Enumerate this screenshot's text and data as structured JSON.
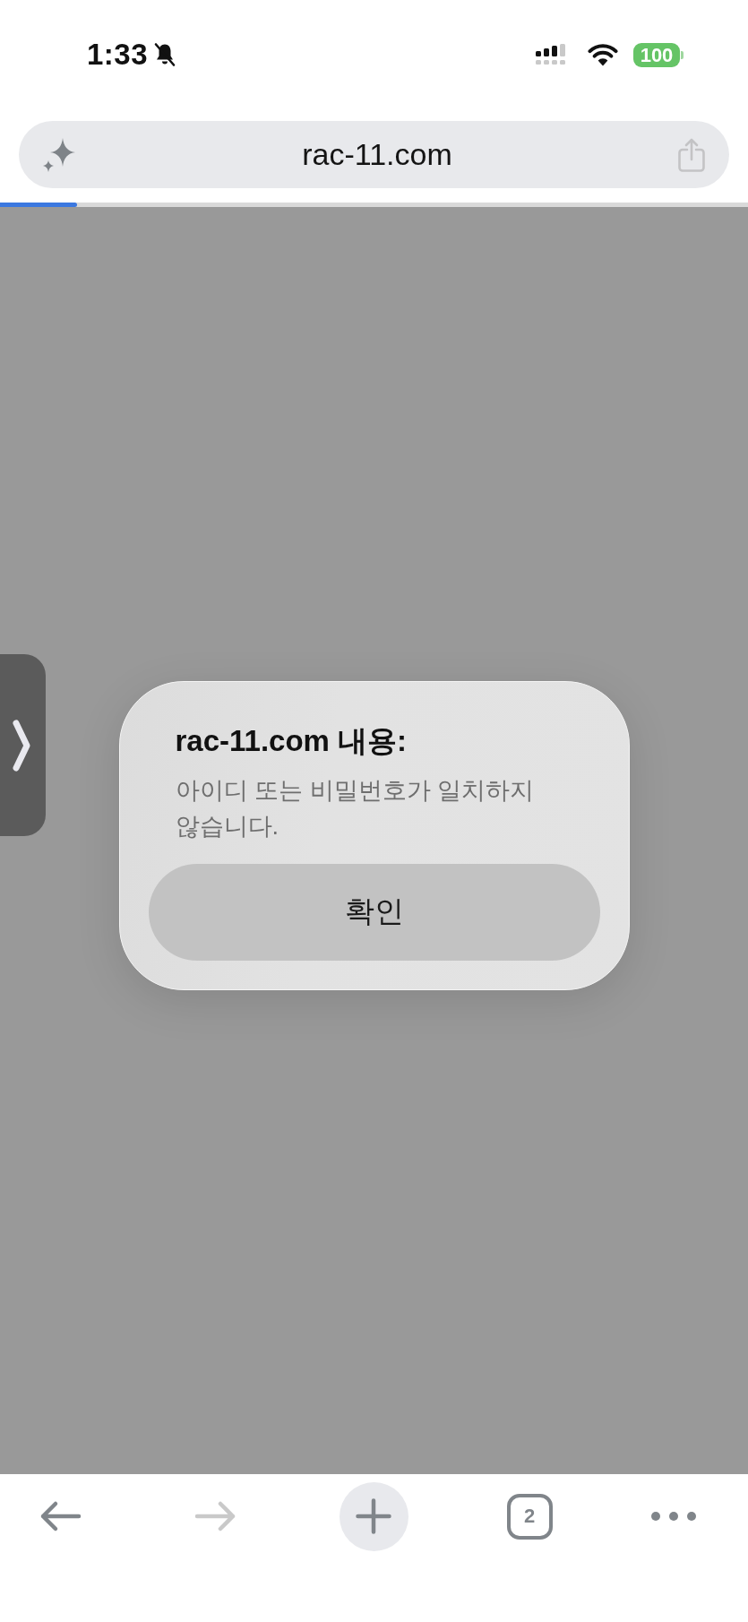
{
  "status_bar": {
    "time": "1:33",
    "silent": true,
    "battery": "100"
  },
  "address_bar": {
    "url": "rac-11.com",
    "progress": {
      "level": 0.103
    }
  },
  "dialog": {
    "title": "rac-11.com 내용:",
    "message": "아이디 또는 비밀번호가 일치하지 않습니다.",
    "buttons": [
      {
        "label": "확인"
      }
    ]
  },
  "toolbar": {
    "items": [
      {
        "kind": "back",
        "disabled": false
      },
      {
        "kind": "forward",
        "disabled": true
      },
      {
        "kind": "new_tab"
      },
      {
        "kind": "tabs",
        "count": "2"
      },
      {
        "kind": "more"
      }
    ]
  }
}
